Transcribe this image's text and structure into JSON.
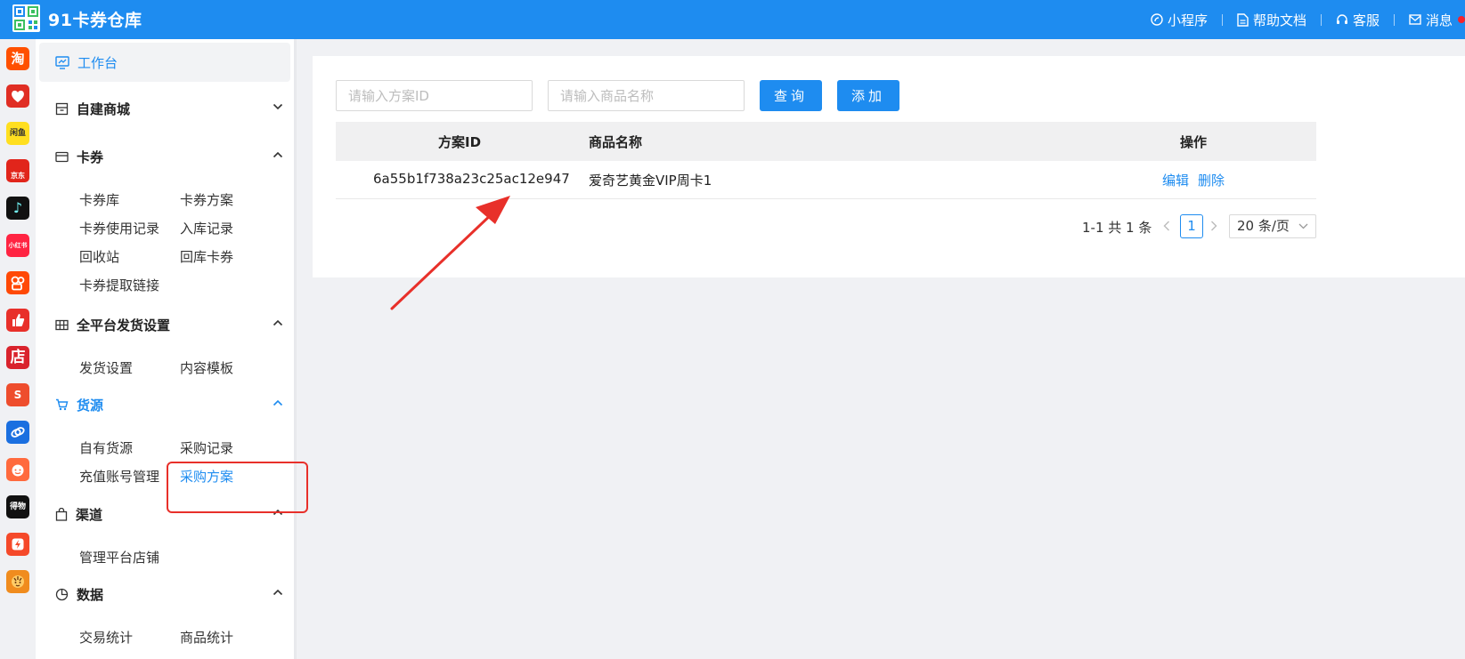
{
  "header": {
    "brand": "91卡券仓库",
    "nav": [
      {
        "icon": "mini-program-icon",
        "label": "小程序"
      },
      {
        "icon": "document-icon",
        "label": "帮助文档"
      },
      {
        "icon": "headset-icon",
        "label": "客服"
      },
      {
        "icon": "mail-icon",
        "label": "消息"
      }
    ]
  },
  "rail": [
    {
      "icon": "taobao-icon",
      "text": "淘",
      "color": "#ff5000"
    },
    {
      "icon": "pinduoduo-icon",
      "text": "",
      "color": "#e02e24"
    },
    {
      "icon": "xianyu-icon",
      "text": "闲鱼",
      "color": "#ffdf20"
    },
    {
      "icon": "jd-icon",
      "text": "京东",
      "color": "#e1251b"
    },
    {
      "icon": "douyin-icon",
      "text": "♪",
      "color": "#111111"
    },
    {
      "icon": "xiaohongshu-icon",
      "text": "小红书",
      "color": "#ff2442"
    },
    {
      "icon": "kuaishou-icon",
      "text": "",
      "color": "#ff4906"
    },
    {
      "icon": "thumbs-up-icon",
      "text": "",
      "color": "#e8302a"
    },
    {
      "icon": "store-icon",
      "text": "店",
      "color": "#d9232d"
    },
    {
      "icon": "shopee-icon",
      "text": "S",
      "color": "#ee4d2d"
    },
    {
      "icon": "link-app-icon",
      "text": "",
      "color": "#1a6fe0"
    },
    {
      "icon": "face-app-icon",
      "text": "",
      "color": "#ff6a3d"
    },
    {
      "icon": "dewu-icon",
      "text": "得物",
      "color": "#111111"
    },
    {
      "icon": "bolt-app-icon",
      "text": "",
      "color": "#f5492a"
    },
    {
      "icon": "tiger-app-icon",
      "text": "",
      "color": "#f08c1e"
    }
  ],
  "sidebar": {
    "workbench": "工作台",
    "groups": [
      {
        "label": "自建商城",
        "items": []
      },
      {
        "label": "卡券",
        "items": [
          "卡券库",
          "卡券方案",
          "卡券使用记录",
          "入库记录",
          "回收站",
          "回库卡券",
          "卡券提取链接"
        ]
      },
      {
        "label": "全平台发货设置",
        "items": [
          "发货设置",
          "内容模板"
        ]
      },
      {
        "label": "货源",
        "items": [
          "自有货源",
          "采购记录",
          "充值账号管理",
          "采购方案"
        ]
      },
      {
        "label": "渠道",
        "items": [
          "管理平台店铺"
        ]
      },
      {
        "label": "数据",
        "items": [
          "交易统计",
          "商品统计"
        ]
      }
    ]
  },
  "search": {
    "plan_id_placeholder": "请输入方案ID",
    "product_name_placeholder": "请输入商品名称",
    "query_label": "查询",
    "add_label": "添加"
  },
  "table": {
    "columns": [
      "方案ID",
      "商品名称",
      "操作"
    ],
    "rows": [
      {
        "plan_id": "6a55b1f738a23c25ac12e947",
        "product_name": "爱奇艺黄金VIP周卡1",
        "actions": [
          "编辑",
          "删除"
        ]
      }
    ]
  },
  "pagination": {
    "summary": "1-1 共 1 条",
    "current_page": "1",
    "page_size": "20 条/页"
  },
  "colors": {
    "primary": "#1e8cf0",
    "highlight": "#e8302a"
  }
}
